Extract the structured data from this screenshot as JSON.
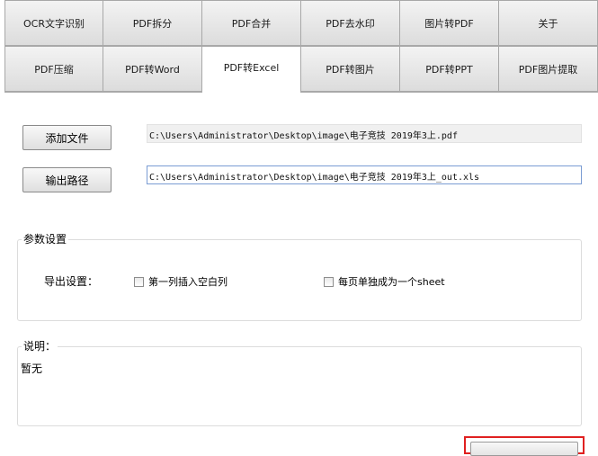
{
  "tabs": {
    "row1": [
      "OCR文字识别",
      "PDF拆分",
      "PDF合并",
      "PDF去水印",
      "图片转PDF",
      "关于"
    ],
    "row2": [
      "PDF压缩",
      "PDF转Word",
      "PDF转Excel",
      "PDF转图片",
      "PDF转PPT",
      "PDF图片提取"
    ],
    "active": "PDF转Excel"
  },
  "file": {
    "add_label": "添加文件",
    "input_path": "C:\\Users\\Administrator\\Desktop\\image\\电子竞技 2019年3上.pdf",
    "output_label": "输出路径",
    "output_path": "C:\\Users\\Administrator\\Desktop\\image\\电子竞技 2019年3上_out.xls"
  },
  "params": {
    "title": "参数设置",
    "export_label": "导出设置：",
    "option1": {
      "label": "第一列插入空白列",
      "checked": false
    },
    "option2": {
      "label": "每页单独成为一个sheet",
      "checked": false
    }
  },
  "description": {
    "title": "说明：",
    "text": "暂无"
  }
}
